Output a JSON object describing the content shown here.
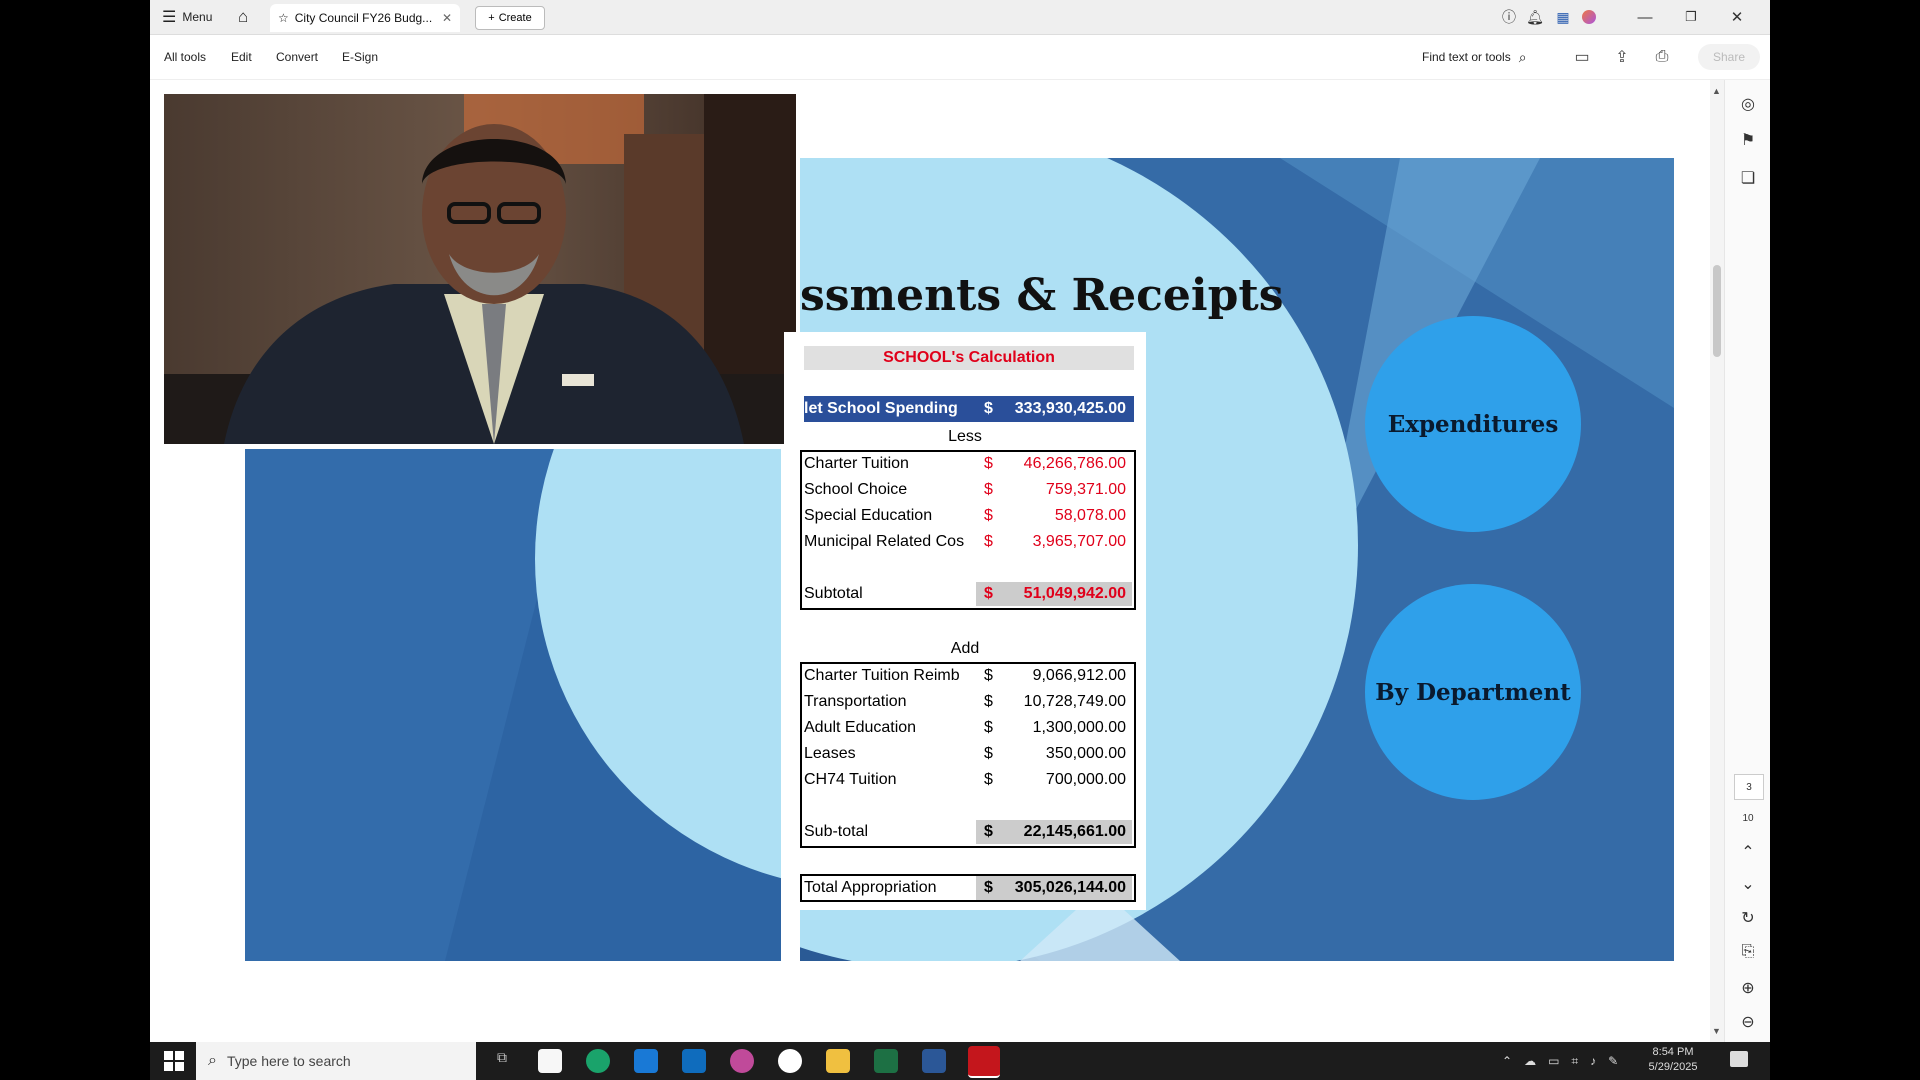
{
  "titlebar": {
    "menu_label": "Menu",
    "tab_title": "City Council FY26 Budg...",
    "create_label": "Create"
  },
  "toolbar": {
    "items": [
      "All tools",
      "Edit",
      "Convert",
      "E-Sign"
    ],
    "find_label": "Find text or tools",
    "share_label": "Share"
  },
  "page_nav": {
    "current": "3",
    "total": "10"
  },
  "slide": {
    "title": "ssments & Receipts",
    "bubble1": "Expenditures",
    "bubble2": "By Department"
  },
  "table": {
    "header": "SCHOOL's Calculation",
    "net_label": "let School Spending",
    "net_currency": "$",
    "net_amount": "333,930,425.00",
    "less_label": "Less",
    "less_rows": [
      {
        "label": "Charter Tuition",
        "currency": "$",
        "amount": "46,266,786.00"
      },
      {
        "label": "School Choice",
        "currency": "$",
        "amount": "759,371.00"
      },
      {
        "label": "Special Education",
        "currency": "$",
        "amount": "58,078.00"
      },
      {
        "label": "Municipal Related Cos",
        "currency": "$",
        "amount": "3,965,707.00"
      }
    ],
    "subtotal_label": "Subtotal",
    "subtotal_currency": "$",
    "subtotal_amount": "51,049,942.00",
    "add_label": "Add",
    "add_rows": [
      {
        "label": "Charter Tuition Reimb",
        "currency": "$",
        "amount": "9,066,912.00"
      },
      {
        "label": "Transportation",
        "currency": "$",
        "amount": "10,728,749.00"
      },
      {
        "label": "Adult Education",
        "currency": "$",
        "amount": "1,300,000.00"
      },
      {
        "label": "Leases",
        "currency": "$",
        "amount": "350,000.00"
      },
      {
        "label": "CH74 Tuition",
        "currency": "$",
        "amount": "700,000.00"
      }
    ],
    "sub_total_label": "Sub-total",
    "sub_total_currency": "$",
    "sub_total_amount": "22,145,661.00",
    "total_label": "Total Appropriation",
    "total_currency": "$",
    "total_amount": "305,026,144.00"
  },
  "taskbar": {
    "search_placeholder": "Type here to search",
    "time": "8:54 PM",
    "date": "5/29/2025"
  },
  "colors": {
    "accent_red": "#e0001a",
    "slide_blue": "#346aa6",
    "bubble_blue": "#2fa0ea",
    "light_cyan": "#aee0f4"
  }
}
